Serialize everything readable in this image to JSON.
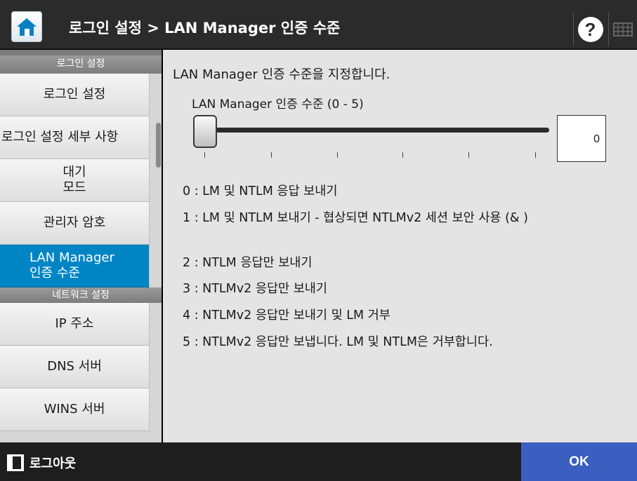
{
  "header": {
    "title": "로그인 설정 > LAN Manager 인증 수준",
    "home_icon": "home-icon",
    "help_label": "?"
  },
  "sidebar": {
    "group_login": "로그인 설정",
    "items_login": [
      {
        "label": "로그인 설정"
      },
      {
        "label": "로그인 설정 세부 사항"
      },
      {
        "label": "대기\n모드"
      },
      {
        "label": "관리자 암호"
      },
      {
        "label": "LAN Manager\n인증 수준",
        "active": true
      }
    ],
    "group_network": "네트워크 설정",
    "items_network": [
      {
        "label": "IP 주소"
      },
      {
        "label": "DNS 서버"
      },
      {
        "label": "WINS 서버"
      }
    ]
  },
  "content": {
    "description": "LAN Manager 인증 수준을 지정합니다.",
    "slider_label": "LAN Manager 인증 수준 (0 - 5)",
    "slider_value": "0",
    "slider_min": 0,
    "slider_max": 5,
    "options": [
      "0 : LM 및 NTLM 응답 보내기",
      "1 : LM 및 NTLM 보내기 - 협상되면 NTLMv2 세션 보안 사용 (& )",
      "2 : NTLM 응답만 보내기",
      "3 : NTLMv2 응답만 보내기",
      "4 : NTLMv2 응답만 보내기 및 LM 거부",
      "5 : NTLMv2 응답만 보냅니다. LM 및 NTLM은 거부합니다."
    ]
  },
  "footer": {
    "logout_label": "로그아웃",
    "ok_label": "OK"
  },
  "colors": {
    "active_item": "#0085c4",
    "ok_button": "#3a5fc0",
    "header_bg": "#2b2b2b"
  }
}
